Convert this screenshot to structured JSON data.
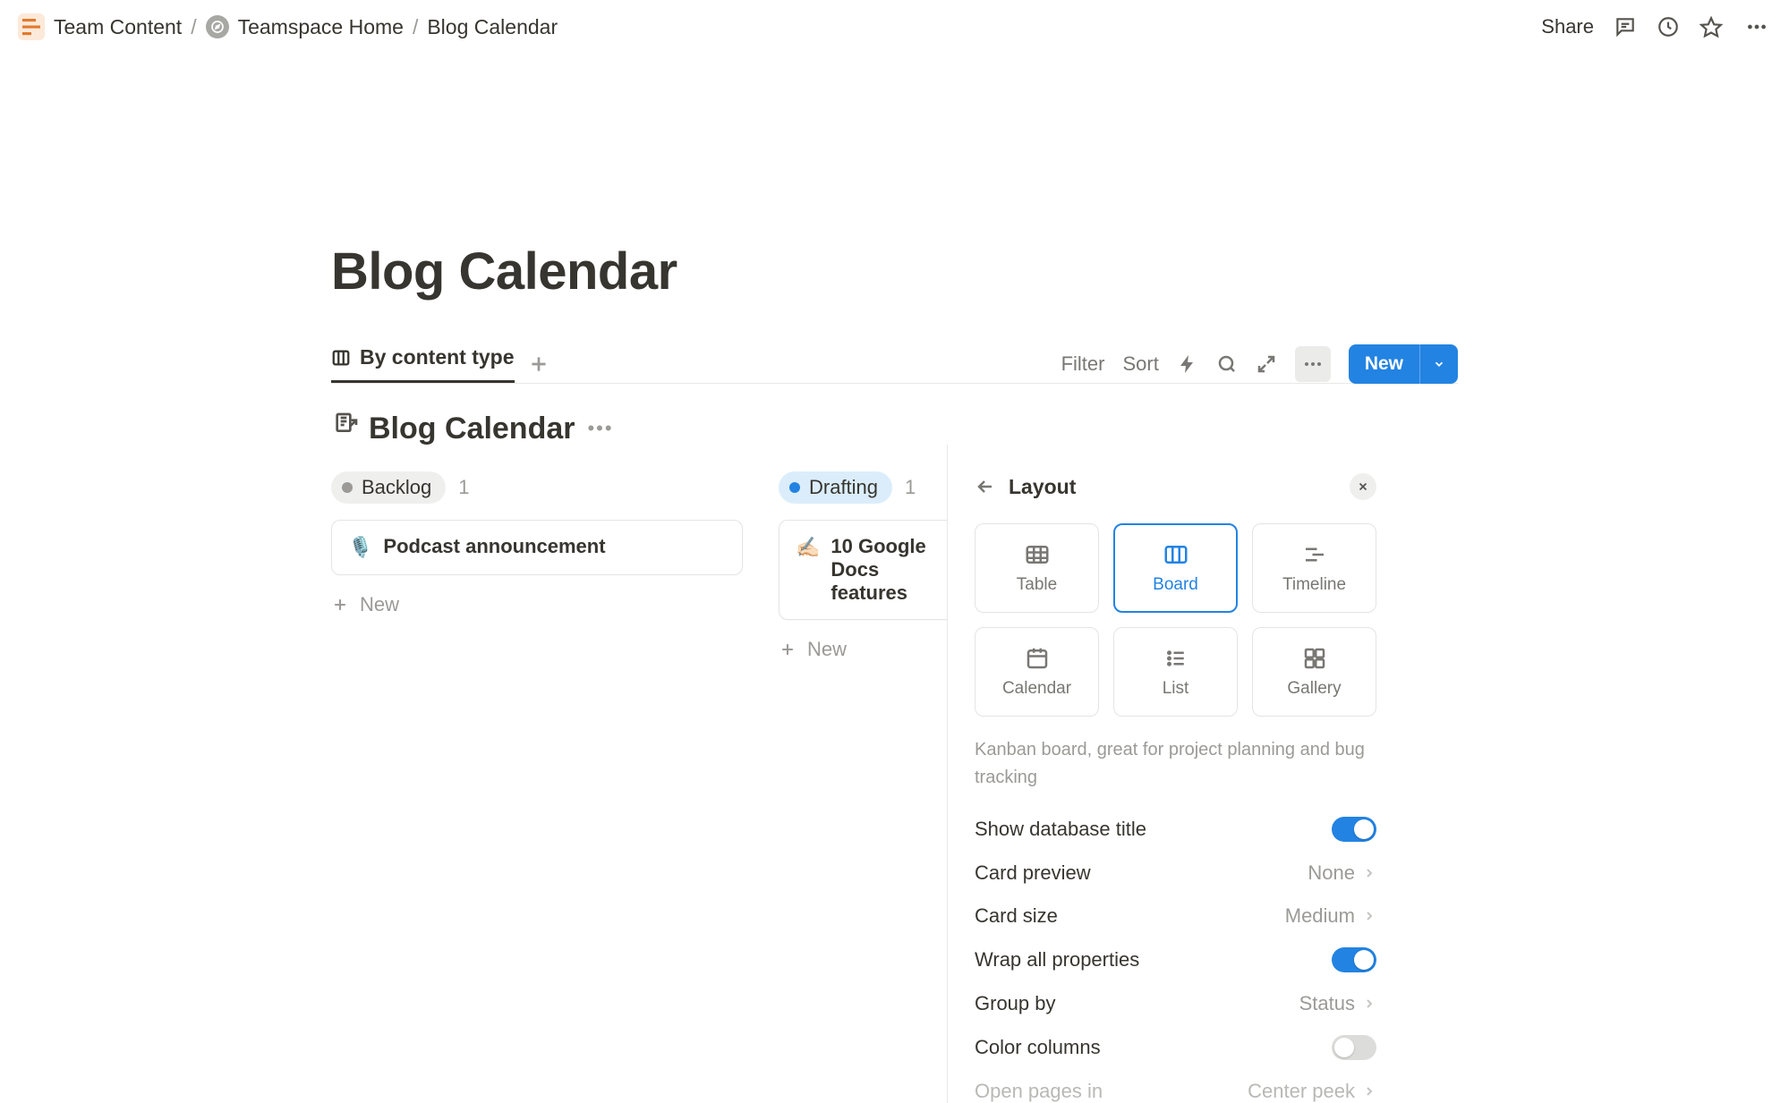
{
  "breadcrumb": {
    "item1": "Team Content",
    "item2": "Teamspace Home",
    "item3": "Blog Calendar"
  },
  "topbar": {
    "share": "Share"
  },
  "page": {
    "title": "Blog Calendar"
  },
  "view": {
    "tab_label": "By content type",
    "filter": "Filter",
    "sort": "Sort",
    "new": "New"
  },
  "db": {
    "emoji": "📝↗",
    "title": "Blog Calendar"
  },
  "board": {
    "columns": [
      {
        "status": "Backlog",
        "count": "1",
        "pill_class": "pill-grey",
        "cards": [
          {
            "emoji": "🎙️",
            "title": "Podcast announcement"
          }
        ],
        "new_label": "New"
      },
      {
        "status": "Drafting",
        "count": "1",
        "pill_class": "pill-blue",
        "cards": [
          {
            "emoji": "✍🏻",
            "title": "10 Google Docs features"
          }
        ],
        "new_label": "New"
      }
    ]
  },
  "panel": {
    "title": "Layout",
    "options": [
      {
        "label": "Table"
      },
      {
        "label": "Board"
      },
      {
        "label": "Timeline"
      },
      {
        "label": "Calendar"
      },
      {
        "label": "List"
      },
      {
        "label": "Gallery"
      }
    ],
    "selected": "Board",
    "description": "Kanban board, great for project planning and bug tracking",
    "settings": {
      "show_db_title": {
        "label": "Show database title",
        "on": true
      },
      "card_preview": {
        "label": "Card preview",
        "value": "None"
      },
      "card_size": {
        "label": "Card size",
        "value": "Medium"
      },
      "wrap_props": {
        "label": "Wrap all properties",
        "on": true
      },
      "group_by": {
        "label": "Group by",
        "value": "Status"
      },
      "color_cols": {
        "label": "Color columns",
        "on": false
      },
      "open_pages": {
        "label": "Open pages in",
        "value": "Center peek"
      }
    }
  }
}
